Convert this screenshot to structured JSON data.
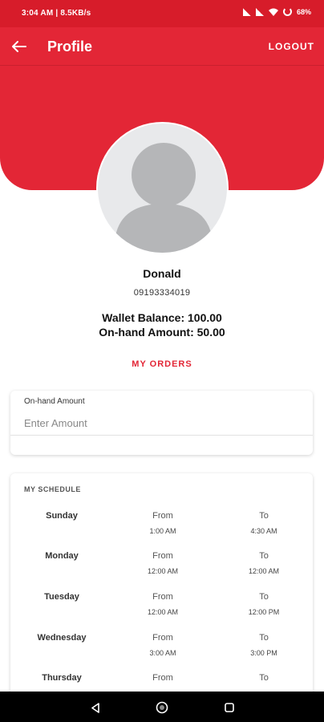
{
  "status_bar": {
    "left_text": "3:04 AM | 8.5KB/s",
    "battery": "68%"
  },
  "header": {
    "title": "Profile",
    "logout_label": "LOGOUT",
    "accent_color": "#e32636"
  },
  "profile": {
    "name": "Donald",
    "phone": "09193334019",
    "wallet_balance": "Wallet Balance: 100.00",
    "onhand_amount": "On-hand Amount: 50.00",
    "orders_link": "MY ORDERS"
  },
  "amount_card": {
    "label": "On-hand Amount",
    "placeholder": "Enter Amount"
  },
  "schedule": {
    "title": "MY SCHEDULE",
    "days": [
      {
        "day": "Sunday",
        "from_label": "From",
        "from": "1:00 AM",
        "to_label": "To",
        "to": "4:30 AM"
      },
      {
        "day": "Monday",
        "from_label": "From",
        "from": "12:00 AM",
        "to_label": "To",
        "to": "12:00 AM"
      },
      {
        "day": "Tuesday",
        "from_label": "From",
        "from": "12:00 AM",
        "to_label": "To",
        "to": "12:00 PM"
      },
      {
        "day": "Wednesday",
        "from_label": "From",
        "from": "3:00 AM",
        "to_label": "To",
        "to": "3:00 PM"
      },
      {
        "day": "Thursday",
        "from_label": "From",
        "from": "",
        "to_label": "To",
        "to": ""
      }
    ]
  },
  "icons": {
    "back": "arrow-left-icon",
    "avatar": "person-icon",
    "nav_back": "triangle-back-icon",
    "nav_home": "circle-home-icon",
    "nav_recents": "square-recents-icon"
  }
}
